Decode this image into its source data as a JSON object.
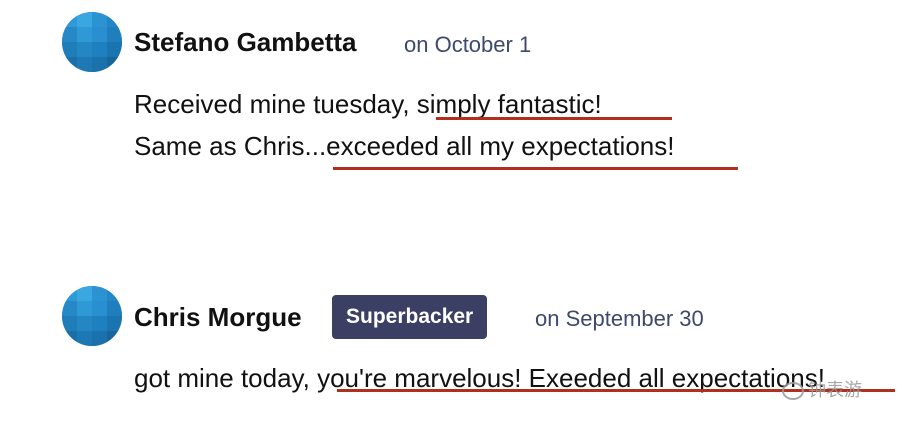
{
  "comments": [
    {
      "author": "Stefano Gambetta",
      "date": "on October 1",
      "lines": [
        "Received mine tuesday, simply fantastic!",
        "Same as Chris...exceeded all my expectations!"
      ]
    },
    {
      "author": "Chris Morgue",
      "badge": "Superbacker",
      "date": "on September 30",
      "lines": [
        "got mine today, you're marvelous! Exeeded all expectations!"
      ]
    }
  ],
  "watermark": "钟表游",
  "colors": {
    "avatar": "#2a8fd0",
    "badge_bg": "#3b3f63",
    "date_text": "#3e4a6b",
    "underline": "#b0301f"
  },
  "icons": {
    "avatar": "avatar-icon",
    "watermark": "chat-bubble-icon"
  }
}
